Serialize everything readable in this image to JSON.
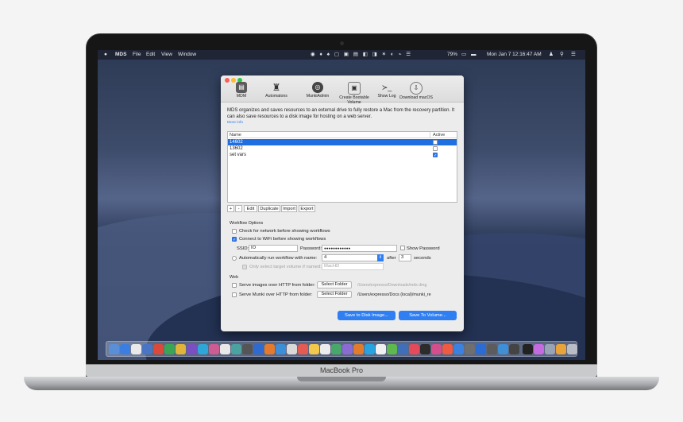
{
  "device": {
    "label": "MacBook Pro"
  },
  "menubar": {
    "apple": "",
    "app_name": "MDS",
    "menus": [
      "File",
      "Edit",
      "View",
      "Window"
    ],
    "battery": "79%",
    "clock": "Mon Jan 7  12:16:47 AM"
  },
  "toolbar": {
    "items": [
      {
        "label": "MDM",
        "icon": "mdm-icon"
      },
      {
        "label": "Automatons",
        "icon": "automaton-icon"
      },
      {
        "label": "MunkiAdmin",
        "icon": "munkiadmin-icon"
      },
      {
        "label": "Create Bootable Volume",
        "icon": "bootable-volume-icon"
      },
      {
        "label": "Show Log",
        "icon": "terminal-icon"
      },
      {
        "label": "Download macOS",
        "icon": "download-icon"
      }
    ]
  },
  "description": {
    "line1": "MDS organizes and saves resources to an external drive to fully restore a Mac from the recovery partition. It",
    "line2": "can also save resources to a disk image for hosting on a web server.",
    "more_info": "More info"
  },
  "workflows": {
    "col_name": "Name",
    "col_active": "Active",
    "rows": [
      {
        "name": "14602",
        "active": false,
        "selected": true
      },
      {
        "name": "13602",
        "active": false,
        "selected": false
      },
      {
        "name": "set vars",
        "active": true,
        "selected": false
      }
    ]
  },
  "list_buttons": {
    "add": "+",
    "remove": "-",
    "edit": "Edit",
    "duplicate": "Duplicate",
    "import": "Import",
    "export": "Export"
  },
  "workflow_options": {
    "heading": "Workflow Options",
    "check_network": "Check for network before showing workflows",
    "connect_wifi": "Connect to WiFi before showing workflows",
    "ssid_label": "SSID:",
    "ssid_value": "IO",
    "password_label": "Password:",
    "password_value": "●●●●●●●●●●●●",
    "show_password": "Show Password",
    "auto_run": "Automatically run workflow with name:",
    "auto_run_value": "4",
    "after_label": "after",
    "after_value": "3",
    "seconds_label": "seconds",
    "only_select": "Only select target volume if named:",
    "only_select_placeholder": "MacHD"
  },
  "web": {
    "heading": "Web",
    "serve_images": "Serve images over HTTP from folder:",
    "serve_images_button": "Select Folder",
    "serve_images_path": "/Users/expresso/Downloads/mds dmg",
    "serve_munki": "Serve Munki over HTTP from folder:",
    "serve_munki_button": "Select Folder",
    "serve_munki_path": "/Users/expresso/Docs (local)/munki_re"
  },
  "actions": {
    "save_disk_image": "Save to Disk Image...",
    "save_volume": "Save To Volume..."
  },
  "colors": {
    "accent": "#2f7ff2",
    "selection": "#1f6fe0"
  }
}
